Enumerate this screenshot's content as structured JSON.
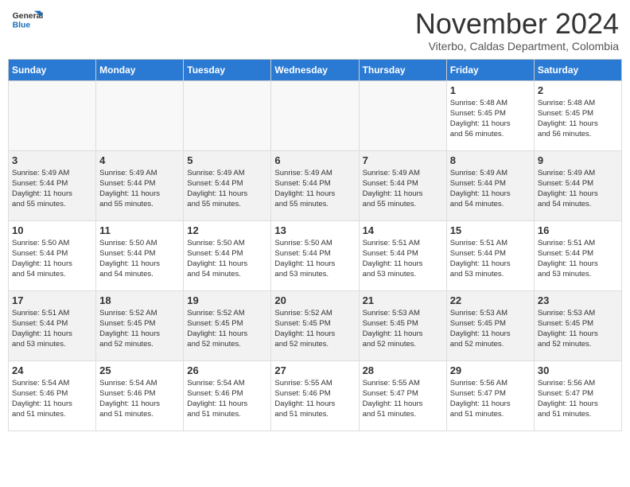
{
  "header": {
    "logo": {
      "line1": "General",
      "line2": "Blue"
    },
    "title": "November 2024",
    "location": "Viterbo, Caldas Department, Colombia"
  },
  "calendar": {
    "weekdays": [
      "Sunday",
      "Monday",
      "Tuesday",
      "Wednesday",
      "Thursday",
      "Friday",
      "Saturday"
    ],
    "weeks": [
      [
        {
          "day": "",
          "info": ""
        },
        {
          "day": "",
          "info": ""
        },
        {
          "day": "",
          "info": ""
        },
        {
          "day": "",
          "info": ""
        },
        {
          "day": "",
          "info": ""
        },
        {
          "day": "1",
          "info": "Sunrise: 5:48 AM\nSunset: 5:45 PM\nDaylight: 11 hours\nand 56 minutes."
        },
        {
          "day": "2",
          "info": "Sunrise: 5:48 AM\nSunset: 5:45 PM\nDaylight: 11 hours\nand 56 minutes."
        }
      ],
      [
        {
          "day": "3",
          "info": "Sunrise: 5:49 AM\nSunset: 5:44 PM\nDaylight: 11 hours\nand 55 minutes."
        },
        {
          "day": "4",
          "info": "Sunrise: 5:49 AM\nSunset: 5:44 PM\nDaylight: 11 hours\nand 55 minutes."
        },
        {
          "day": "5",
          "info": "Sunrise: 5:49 AM\nSunset: 5:44 PM\nDaylight: 11 hours\nand 55 minutes."
        },
        {
          "day": "6",
          "info": "Sunrise: 5:49 AM\nSunset: 5:44 PM\nDaylight: 11 hours\nand 55 minutes."
        },
        {
          "day": "7",
          "info": "Sunrise: 5:49 AM\nSunset: 5:44 PM\nDaylight: 11 hours\nand 55 minutes."
        },
        {
          "day": "8",
          "info": "Sunrise: 5:49 AM\nSunset: 5:44 PM\nDaylight: 11 hours\nand 54 minutes."
        },
        {
          "day": "9",
          "info": "Sunrise: 5:49 AM\nSunset: 5:44 PM\nDaylight: 11 hours\nand 54 minutes."
        }
      ],
      [
        {
          "day": "10",
          "info": "Sunrise: 5:50 AM\nSunset: 5:44 PM\nDaylight: 11 hours\nand 54 minutes."
        },
        {
          "day": "11",
          "info": "Sunrise: 5:50 AM\nSunset: 5:44 PM\nDaylight: 11 hours\nand 54 minutes."
        },
        {
          "day": "12",
          "info": "Sunrise: 5:50 AM\nSunset: 5:44 PM\nDaylight: 11 hours\nand 54 minutes."
        },
        {
          "day": "13",
          "info": "Sunrise: 5:50 AM\nSunset: 5:44 PM\nDaylight: 11 hours\nand 53 minutes."
        },
        {
          "day": "14",
          "info": "Sunrise: 5:51 AM\nSunset: 5:44 PM\nDaylight: 11 hours\nand 53 minutes."
        },
        {
          "day": "15",
          "info": "Sunrise: 5:51 AM\nSunset: 5:44 PM\nDaylight: 11 hours\nand 53 minutes."
        },
        {
          "day": "16",
          "info": "Sunrise: 5:51 AM\nSunset: 5:44 PM\nDaylight: 11 hours\nand 53 minutes."
        }
      ],
      [
        {
          "day": "17",
          "info": "Sunrise: 5:51 AM\nSunset: 5:44 PM\nDaylight: 11 hours\nand 53 minutes."
        },
        {
          "day": "18",
          "info": "Sunrise: 5:52 AM\nSunset: 5:45 PM\nDaylight: 11 hours\nand 52 minutes."
        },
        {
          "day": "19",
          "info": "Sunrise: 5:52 AM\nSunset: 5:45 PM\nDaylight: 11 hours\nand 52 minutes."
        },
        {
          "day": "20",
          "info": "Sunrise: 5:52 AM\nSunset: 5:45 PM\nDaylight: 11 hours\nand 52 minutes."
        },
        {
          "day": "21",
          "info": "Sunrise: 5:53 AM\nSunset: 5:45 PM\nDaylight: 11 hours\nand 52 minutes."
        },
        {
          "day": "22",
          "info": "Sunrise: 5:53 AM\nSunset: 5:45 PM\nDaylight: 11 hours\nand 52 minutes."
        },
        {
          "day": "23",
          "info": "Sunrise: 5:53 AM\nSunset: 5:45 PM\nDaylight: 11 hours\nand 52 minutes."
        }
      ],
      [
        {
          "day": "24",
          "info": "Sunrise: 5:54 AM\nSunset: 5:46 PM\nDaylight: 11 hours\nand 51 minutes."
        },
        {
          "day": "25",
          "info": "Sunrise: 5:54 AM\nSunset: 5:46 PM\nDaylight: 11 hours\nand 51 minutes."
        },
        {
          "day": "26",
          "info": "Sunrise: 5:54 AM\nSunset: 5:46 PM\nDaylight: 11 hours\nand 51 minutes."
        },
        {
          "day": "27",
          "info": "Sunrise: 5:55 AM\nSunset: 5:46 PM\nDaylight: 11 hours\nand 51 minutes."
        },
        {
          "day": "28",
          "info": "Sunrise: 5:55 AM\nSunset: 5:47 PM\nDaylight: 11 hours\nand 51 minutes."
        },
        {
          "day": "29",
          "info": "Sunrise: 5:56 AM\nSunset: 5:47 PM\nDaylight: 11 hours\nand 51 minutes."
        },
        {
          "day": "30",
          "info": "Sunrise: 5:56 AM\nSunset: 5:47 PM\nDaylight: 11 hours\nand 51 minutes."
        }
      ]
    ]
  }
}
